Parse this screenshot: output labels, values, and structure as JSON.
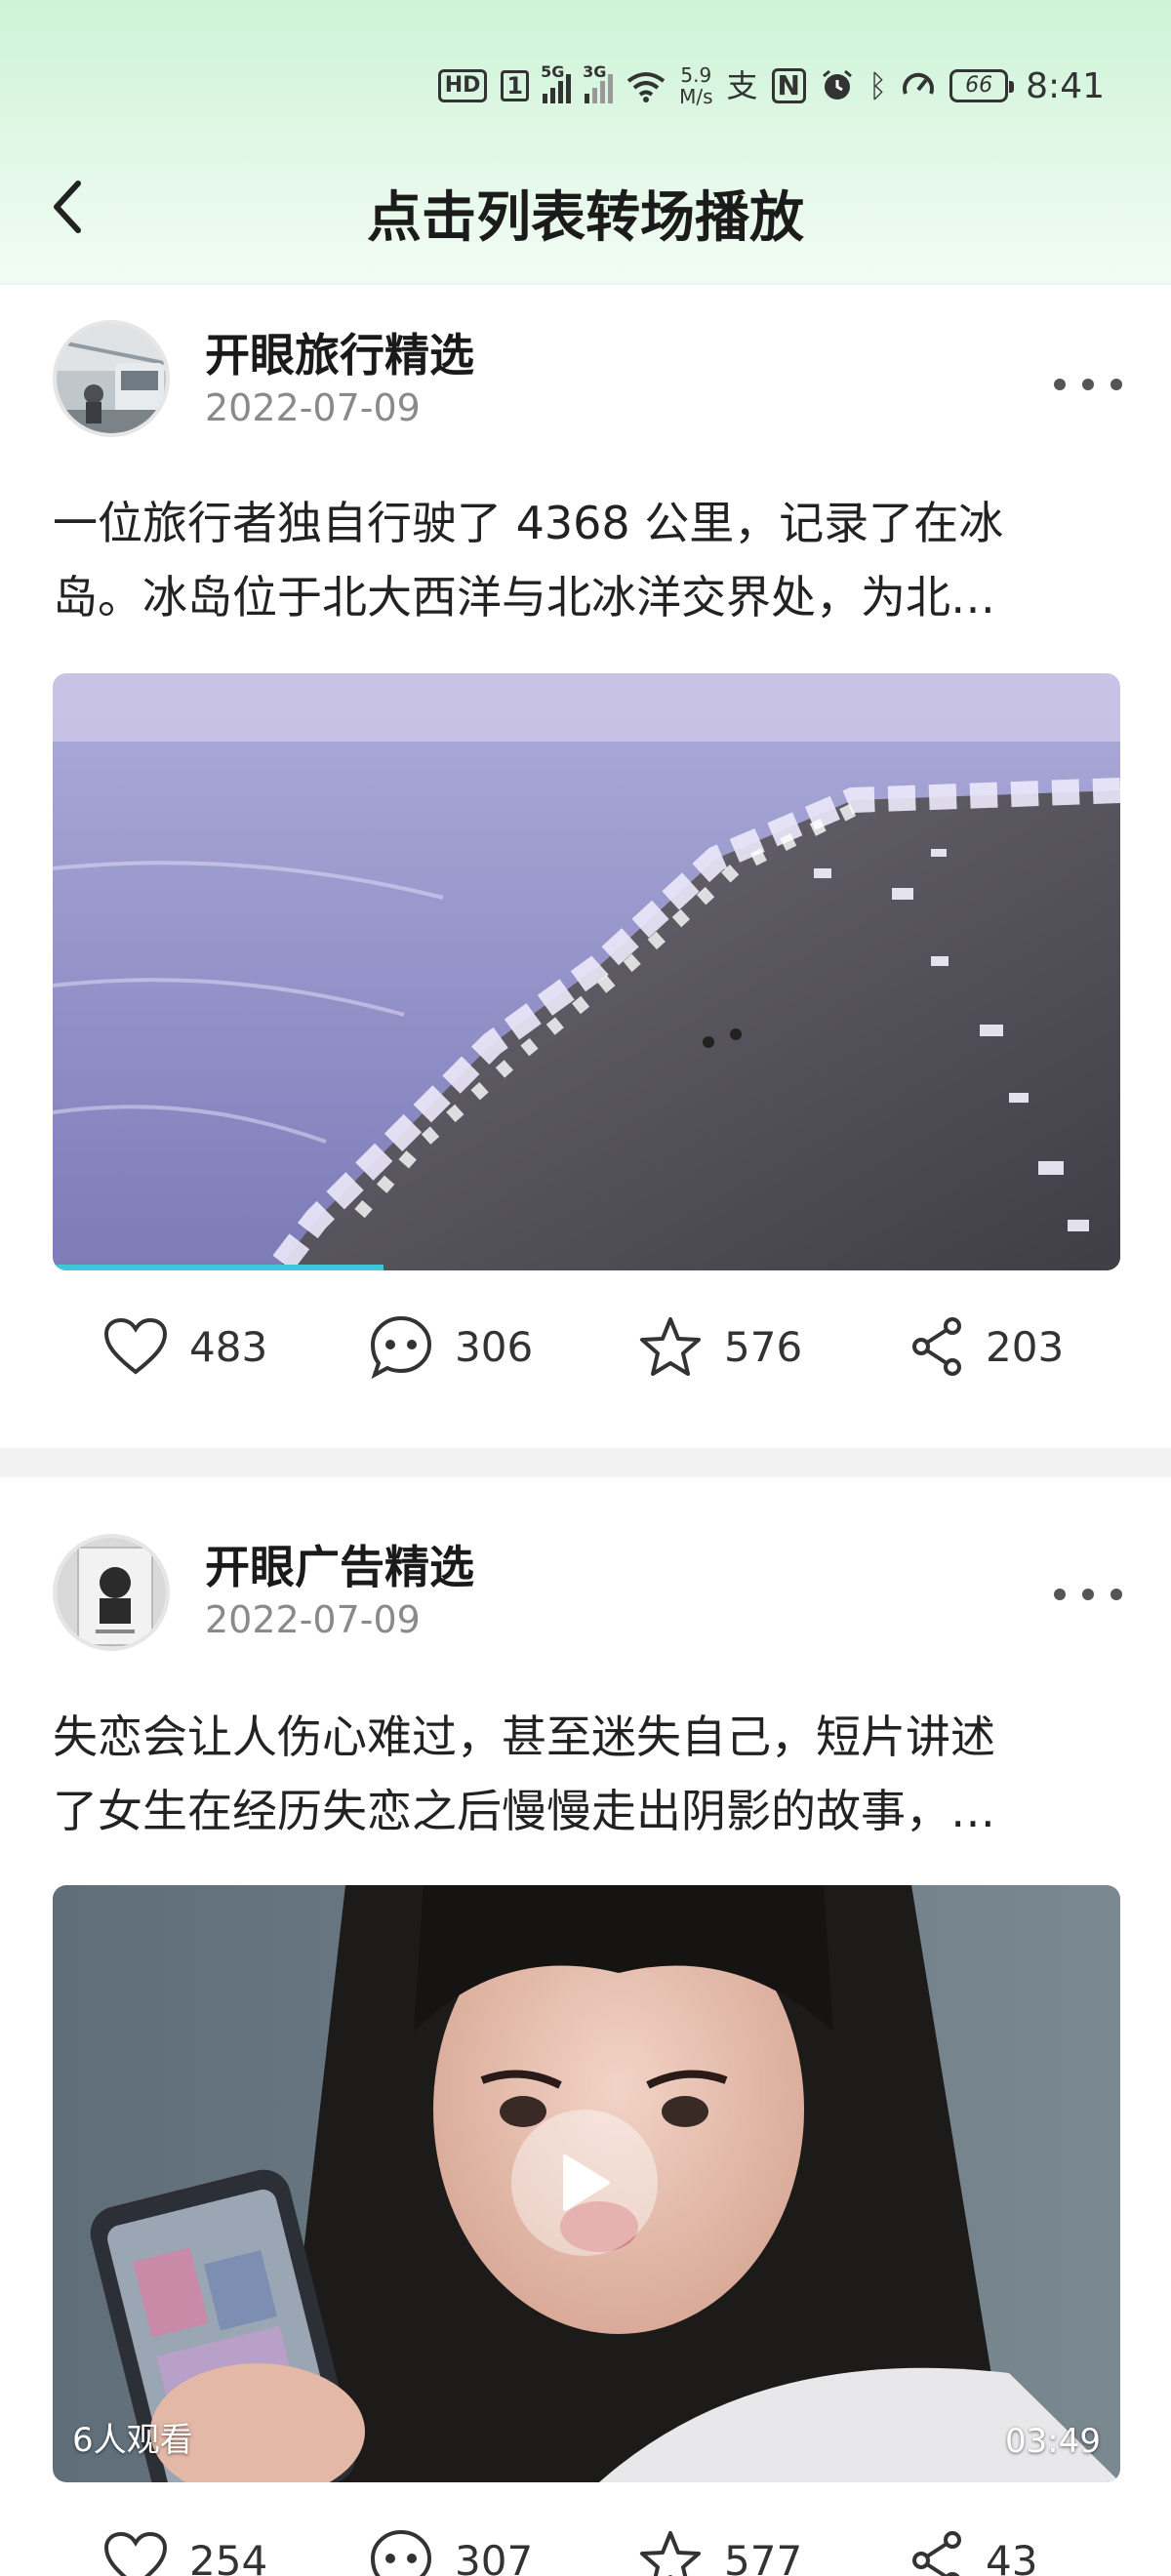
{
  "status_bar": {
    "hd": "HD",
    "sim": "1",
    "net1": "5G",
    "net2": "3G",
    "speed_value": "5.9",
    "speed_unit": "M/s",
    "battery": "66",
    "time": "8:41",
    "icons": [
      "wifi-icon",
      "alipay-icon",
      "nfc-icon",
      "alarm-icon",
      "bluetooth-icon",
      "gauge-icon"
    ]
  },
  "header": {
    "title": "点击列表转场播放",
    "back_icon": "chevron-left-icon"
  },
  "colors": {
    "header_gradient_top": "#cdf3d6",
    "progress": "#3ec7d6",
    "divider": "#f2f2f2"
  },
  "feed": [
    {
      "author": "开眼旅行精选",
      "date": "2022-07-09",
      "description_line1": "一位旅行者独自行驶了 4368 公里，记录了在冰",
      "description_line2": "岛。冰岛位于北大西洋与北冰洋交界处，为北…",
      "media_subject": "icy-beach-aerial",
      "playback_progress": 0.31,
      "likes": "483",
      "comments": "306",
      "favorites": "576",
      "shares": "203"
    },
    {
      "author": "开眼广告精选",
      "date": "2022-07-09",
      "description_line1": "失恋会让人伤心难过，甚至迷失自己，短片讲述",
      "description_line2": "了女生在经历失恋之后慢慢走出阴影的故事，…",
      "media_subject": "girl-looking-at-phone",
      "watchers": "6人观看",
      "duration": "03:49",
      "likes": "254",
      "comments": "307",
      "favorites": "577",
      "shares": "43"
    }
  ]
}
